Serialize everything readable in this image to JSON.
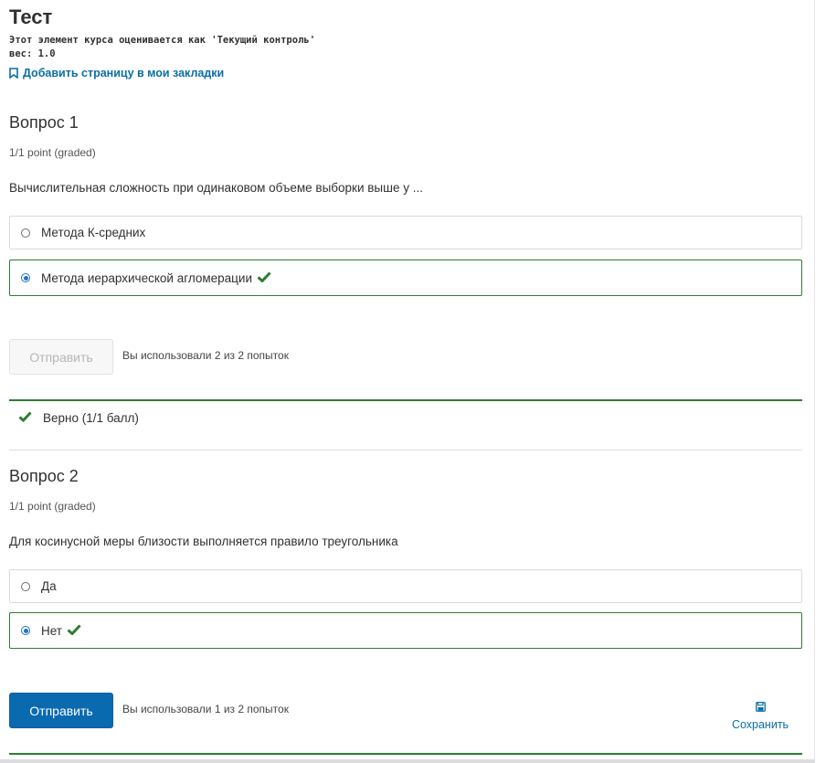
{
  "header": {
    "title": "Тест",
    "grading_note": "Этот элемент курса оценивается как 'Текущий контроль'",
    "weight": "вес: 1.0",
    "bookmark_label": "Добавить страницу в мои закладки"
  },
  "questions": [
    {
      "title": "Вопрос 1",
      "points": "1/1 point (graded)",
      "prompt": "Вычислительная сложность при одинаковом объеме выборки выше у ...",
      "choices": [
        {
          "label": "Метода К-средних",
          "selected": false
        },
        {
          "label": "Метода иерархической агломерации",
          "selected": true,
          "correct": true
        }
      ],
      "submit_label": "Отправить",
      "submit_disabled": true,
      "attempts": "Вы использовали 2 из 2 попыток",
      "result": "Верно (1/1 балл)"
    },
    {
      "title": "Вопрос 2",
      "points": "1/1 point (graded)",
      "prompt": "Для косинусной меры близости выполняется правило треугольника",
      "choices": [
        {
          "label": "Да",
          "selected": false
        },
        {
          "label": "Нет",
          "selected": true,
          "correct": true
        }
      ],
      "submit_label": "Отправить",
      "submit_disabled": false,
      "attempts": "Вы использовали 1 из 2 попыток",
      "save_label": "Сохранить"
    }
  ],
  "colors": {
    "correct": "#2e7d32",
    "link": "#0a6ea7",
    "primary_button": "#0a6ab0"
  }
}
